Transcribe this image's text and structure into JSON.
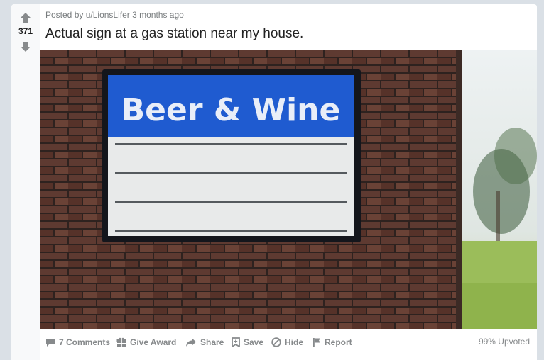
{
  "post": {
    "score": "371",
    "posted_by_prefix": "Posted by",
    "author": "u/LionsLifer",
    "time_ago": "3 months ago",
    "title": "Actual sign at a gas station near my house.",
    "image": {
      "sign_text": "Beer & Wine",
      "colors": {
        "sign_blue": "#1f5bd0",
        "brick": "#5e3a31",
        "frame": "#14161c"
      }
    },
    "actions": {
      "comments": "7 Comments",
      "give_award": "Give Award",
      "share": "Share",
      "save": "Save",
      "hide": "Hide",
      "report": "Report"
    },
    "upvoted": "99% Upvoted"
  },
  "icons": [
    "upvote-icon",
    "downvote-icon",
    "comment-icon",
    "gift-icon",
    "share-icon",
    "save-icon",
    "hide-icon",
    "report-icon"
  ]
}
